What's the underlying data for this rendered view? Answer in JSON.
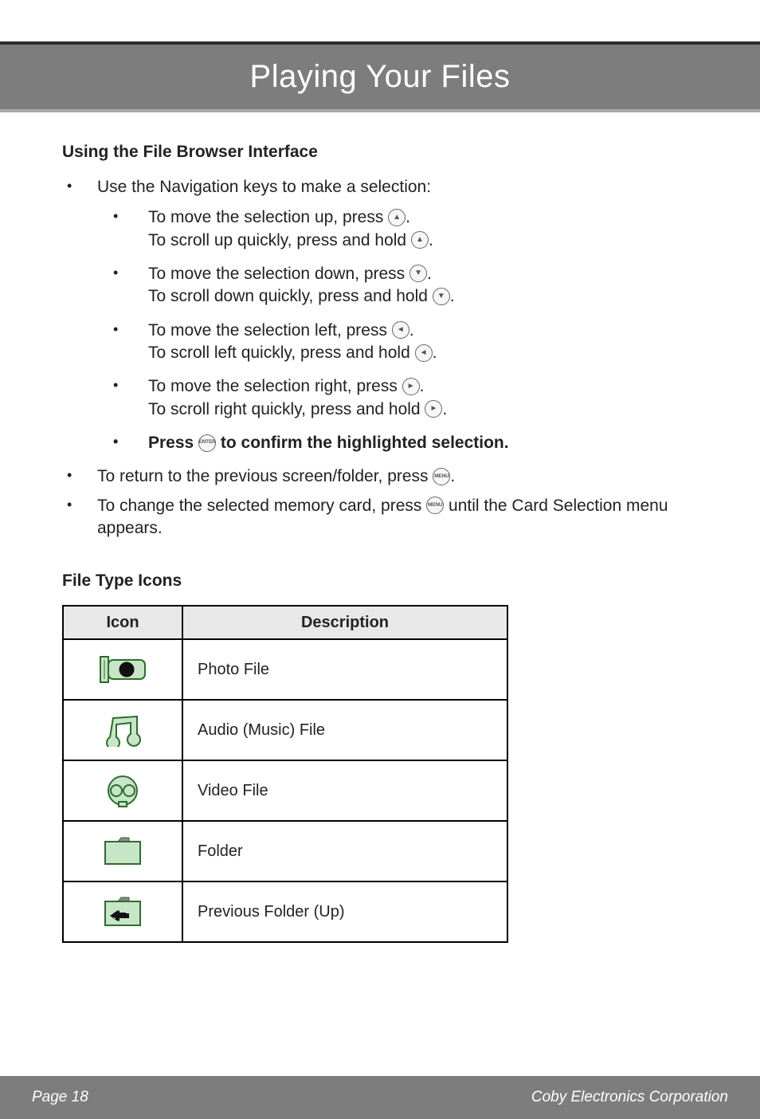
{
  "banner": {
    "title": "Playing Your Files"
  },
  "section1": {
    "heading": "Using the File Browser Interface",
    "nav_intro": "Use the Navigation keys to make a selection:",
    "items": [
      {
        "line1a": "To move the selection up, press ",
        "line1b": ".",
        "line2a": "To scroll up quickly, press and hold ",
        "line2b": ".",
        "glyph": "▲"
      },
      {
        "line1a": "To move the selection down, press ",
        "line1b": ".",
        "line2a": "To scroll down quickly, press and hold ",
        "line2b": ".",
        "glyph": "▼"
      },
      {
        "line1a": "To move the selection left, press ",
        "line1b": ".",
        "line2a": "To scroll left quickly, press and hold ",
        "line2b": ".",
        "glyph": "◄"
      },
      {
        "line1a": "To move the selection right, press ",
        "line1b": ".",
        "line2a": "To scroll right quickly, press and hold ",
        "line2b": ".",
        "glyph": "►"
      }
    ],
    "confirm_a": "Press ",
    "confirm_b": " to confirm the highlighted selection.",
    "confirm_btn": "ENTER",
    "return_a": "To return to the previous screen/folder, press ",
    "return_b": ".",
    "return_btn": "MENU",
    "change_a": "To change the selected memory card, press ",
    "change_b": " until the Card Selection menu appears.",
    "change_btn": "MENU"
  },
  "section2": {
    "heading": "File Type Icons",
    "col1": "Icon",
    "col2": "Description",
    "rows": [
      {
        "desc": "Photo File"
      },
      {
        "desc": "Audio (Music) File"
      },
      {
        "desc": "Video File"
      },
      {
        "desc": "Folder"
      },
      {
        "desc": "Previous Folder (Up)"
      }
    ]
  },
  "footer": {
    "left": "Page 18",
    "right": "Coby Electronics Corporation"
  }
}
